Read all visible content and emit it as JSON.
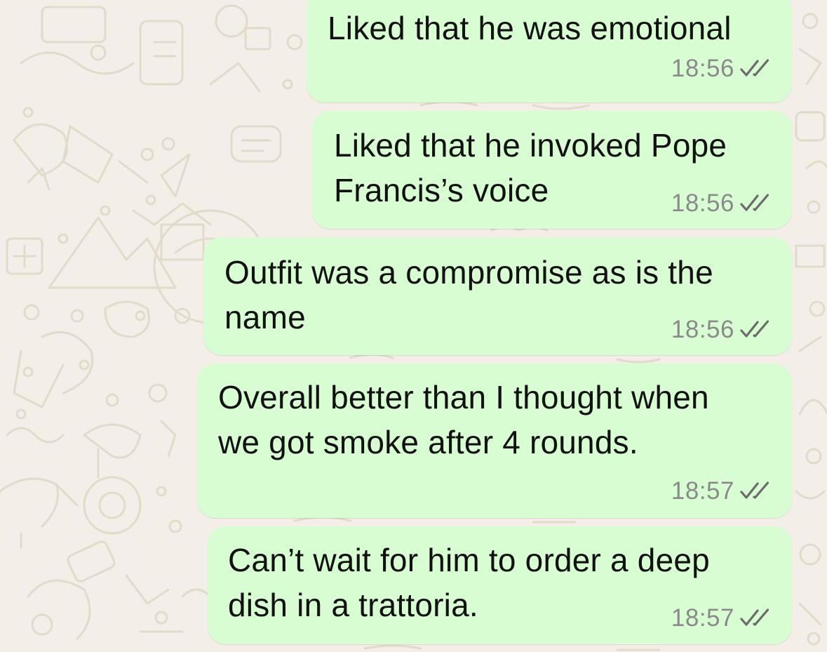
{
  "colors": {
    "wallpaper": "#f3efe8",
    "doodle": "#e4ddd0",
    "outgoing_bubble": "#d9fdd3",
    "message_text": "#111111",
    "timestamp": "#8a8a8a",
    "read_ticks": "#6b6b6b"
  },
  "status_icon": "double-check-icon",
  "messages": [
    {
      "text": "Liked that he was emotional",
      "time": "18:56"
    },
    {
      "text": "Liked that he invoked Pope\nFrancis’s voice",
      "time": "18:56"
    },
    {
      "text": "Outfit was a compromise as is the\nname",
      "time": "18:56"
    },
    {
      "text": "Overall better than I thought when\nwe got smoke after 4 rounds.",
      "time": "18:57"
    },
    {
      "text": "Can’t wait for him to order a deep\ndish in a trattoria.",
      "time": "18:57"
    }
  ]
}
